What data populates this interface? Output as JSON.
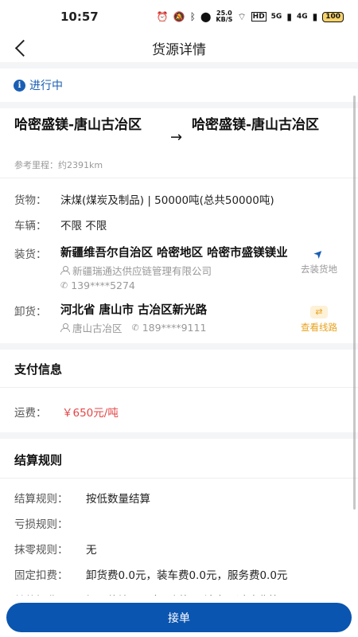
{
  "status_bar": {
    "time": "10:57",
    "speed_value": "25.0",
    "speed_unit": "KB/S",
    "hd": "HD",
    "net1": "5G",
    "net2": "4G",
    "battery": "100"
  },
  "header": {
    "title": "货源详情"
  },
  "status": {
    "icon": "info-icon",
    "text": "进行中"
  },
  "route": {
    "from": "哈密盛镁-唐山古冶区",
    "to": "哈密盛镁-唐山古冶区",
    "arrow": "→",
    "distance": "参考里程：约2391km"
  },
  "goods": {
    "cargo_label": "货物：",
    "cargo_value": "沫煤(煤炭及制品) | 50000吨(总共50000吨)",
    "vehicle_label": "车辆：",
    "vehicle_value": "不限 不限"
  },
  "loading": {
    "label": "装货：",
    "address": "新疆维吾尔自治区 哈密地区 哈密市盛镁镁业",
    "company": "新疆瑞通达供应链管理有限公司",
    "phone": "139****5274",
    "action_label": "去装货地"
  },
  "unloading": {
    "label": "卸货：",
    "address": "河北省 唐山市 古冶区新光路",
    "contact": "唐山古冶区",
    "phone": "189****9111",
    "action_label": "查看线路"
  },
  "payment": {
    "title": "支付信息",
    "freight_label": "运费：",
    "freight_value": "￥650元/吨"
  },
  "settlement": {
    "title": "结算规则",
    "rows": [
      {
        "label": "结算规则：",
        "value": "按低数量结算"
      },
      {
        "label": "亏损规则：",
        "value": ""
      },
      {
        "label": "抹零规则：",
        "value": "无"
      },
      {
        "label": "固定扣费：",
        "value": "卸货费0.0元，装车费0.0元，服务费0.0元"
      },
      {
        "label": "其他扣费：",
        "value": "视具体情况而定，例如：油卡、过路费等"
      }
    ]
  },
  "footer": {
    "accept_label": "接单"
  },
  "colors": {
    "primary": "#0a55b0",
    "accent_orange": "#e7a21e",
    "price_red": "#e64545"
  }
}
